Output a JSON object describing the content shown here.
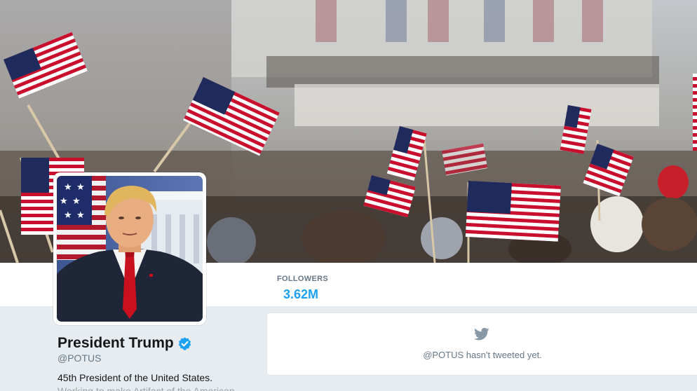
{
  "profile": {
    "name": "President Trump",
    "screen_name": "@POTUS",
    "bio": "45th President of the United States.",
    "bio_more": "Working to make Artifact of the American..."
  },
  "stats": {
    "followers_label": "FOLLOWERS",
    "followers_value": "3.62M"
  },
  "timeline": {
    "empty_message": "@POTUS hasn't tweeted yet."
  },
  "colors": {
    "accent": "#1da1f2",
    "muted": "#657786",
    "background": "#e6ecf0"
  },
  "icons": {
    "verified": "verified-badge-icon",
    "bird": "twitter-bird-icon"
  }
}
